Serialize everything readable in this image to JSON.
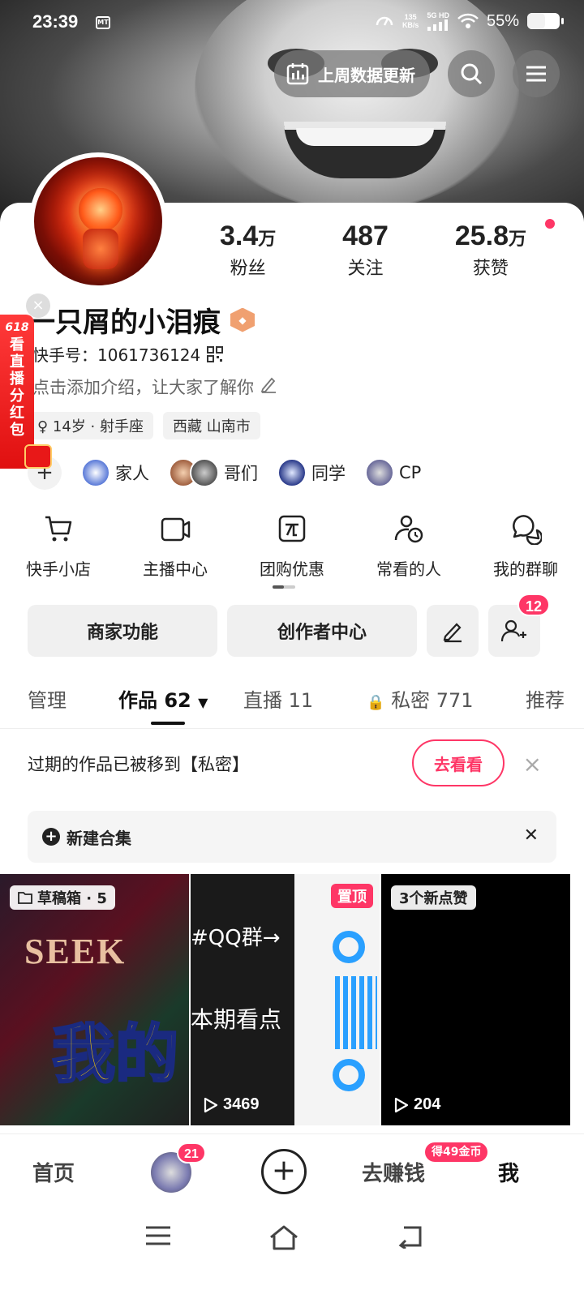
{
  "status_bar": {
    "time": "23:39",
    "speed_value": "135",
    "speed_unit": "KB/s",
    "network": "5G HD",
    "battery": "55%",
    "battery_level": 0.55
  },
  "header": {
    "data_update_label": "上周数据更新"
  },
  "profile": {
    "stats": [
      {
        "value": "3.4",
        "unit": "万",
        "label": "粉丝"
      },
      {
        "value": "487",
        "unit": "",
        "label": "关注"
      },
      {
        "value": "25.8",
        "unit": "万",
        "label": "获赞"
      }
    ],
    "name": "一只屑的小泪痕",
    "kuaishou_id": "快手号：1061736124",
    "intro": "点击添加介绍，让大家了解你",
    "tags": [
      "14岁 · 射手座",
      "西藏 山南市"
    ],
    "relations": [
      "家人",
      "哥们",
      "同学",
      "CP"
    ]
  },
  "side_banner": {
    "top": "618",
    "text": [
      "看",
      "直",
      "播",
      "分",
      "红",
      "包"
    ]
  },
  "tools": [
    {
      "icon": "cart-icon",
      "label": "快手小店"
    },
    {
      "icon": "camera-icon",
      "label": "主播中心"
    },
    {
      "icon": "group-buy-icon",
      "label": "团购优惠"
    },
    {
      "icon": "person-clock-icon",
      "label": "常看的人"
    },
    {
      "icon": "chat-icon",
      "label": "我的群聊"
    }
  ],
  "actions": {
    "merchant": "商家功能",
    "creator": "创作者中心",
    "friend_requests": "12"
  },
  "tabs": {
    "manage": "管理",
    "works": "作品 62",
    "live": "直播 11",
    "private": "私密 771",
    "recommend": "推荐"
  },
  "notice": {
    "text": "过期的作品已被移到【私密】",
    "button": "去看看"
  },
  "collection": {
    "label": "新建合集"
  },
  "grid": [
    {
      "tag": "草稿箱 · 5",
      "overlay_a": "SEEK",
      "overlay_b": "我的"
    },
    {
      "pin": "置顶",
      "overlay_a": "#QQ群→",
      "overlay_b": "本期看点",
      "plays": "3469"
    },
    {
      "tag": "3个新点赞",
      "plays": "204"
    }
  ],
  "bottom_nav": {
    "home": "首页",
    "avatar_badge": "21",
    "earn": "去赚钱",
    "coin_badge": "得49金币",
    "me": "我"
  }
}
